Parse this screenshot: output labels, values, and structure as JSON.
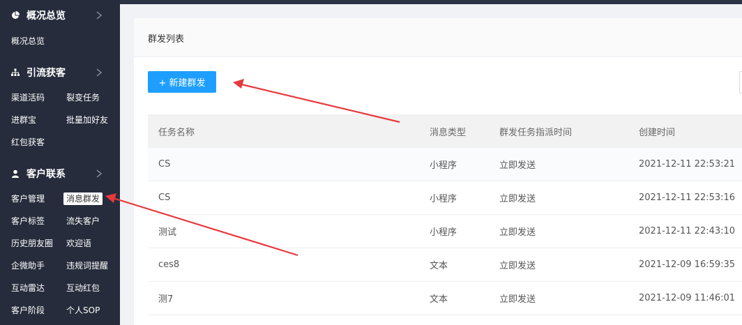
{
  "sidebar": {
    "sections": [
      {
        "title": "概况总览",
        "icon": "pie-chart-icon",
        "items": [
          "概况总览"
        ]
      },
      {
        "title": "引流获客",
        "icon": "org-tree-icon",
        "items": [
          "渠道活码",
          "裂变任务",
          "进群宝",
          "批量加好友",
          "红包获客"
        ]
      },
      {
        "title": "客户联系",
        "icon": "user-icon",
        "items": [
          "客户管理",
          "消息群发",
          "客户标签",
          "流失客户",
          "历史朋友圈",
          "欢迎语",
          "企微助手",
          "违规词提醒",
          "互动雷达",
          "互动红包",
          "客户阶段",
          "个人SOP"
        ]
      }
    ],
    "active_item": "消息群发"
  },
  "main": {
    "panel_title": "群发列表",
    "new_button_label": "+ 新建群发",
    "table": {
      "headers": [
        "任务名称",
        "消息类型",
        "群发任务指派时间",
        "创建时间"
      ],
      "rows": [
        [
          "CS",
          "小程序",
          "立即发送",
          "2021-12-11 22:53:21"
        ],
        [
          "CS",
          "小程序",
          "立即发送",
          "2021-12-11 22:53:16"
        ],
        [
          "测试",
          "小程序",
          "立即发送",
          "2021-12-11 22:43:10"
        ],
        [
          "ces8",
          "文本",
          "立即发送",
          "2021-12-09 16:59:35"
        ],
        [
          "测7",
          "文本",
          "立即发送",
          "2021-12-09 11:46:01"
        ]
      ]
    }
  },
  "colors": {
    "sidebar_bg": "#262c3b",
    "primary_button": "#1e9fff",
    "annotation_arrow": "#e8383d"
  }
}
